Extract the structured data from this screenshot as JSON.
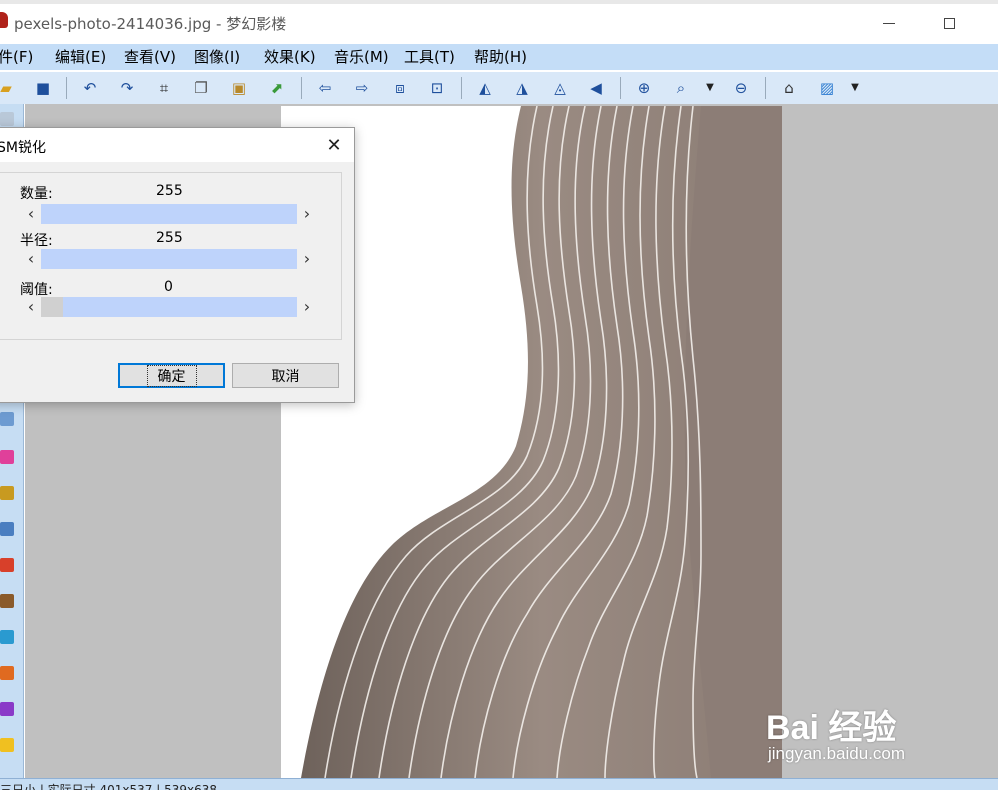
{
  "window": {
    "title": "pexels-photo-2414036.jpg - 梦幻影楼"
  },
  "menu": [
    {
      "label": "件(F)"
    },
    {
      "label": "编辑(E)"
    },
    {
      "label": "查看(V)"
    },
    {
      "label": "图像(I)"
    },
    {
      "label": "效果(K)"
    },
    {
      "label": "音乐(M)"
    },
    {
      "label": "工具(T)"
    },
    {
      "label": "帮助(H)"
    }
  ],
  "toolbar": {
    "icons": [
      "open-folder-icon",
      "save-icon",
      "undo-icon",
      "redo-icon",
      "crop-icon",
      "copy-icon",
      "paste-icon",
      "export-icon",
      "arrow-left-icon",
      "arrow-right-icon",
      "fit-window-icon",
      "actual-size-icon",
      "flip-icon",
      "mirror-icon",
      "rotate-icon",
      "triangle-icon",
      "zoom-in-icon",
      "zoom-icon",
      "zoom-out-icon",
      "home-icon",
      "wallpaper-icon"
    ]
  },
  "dialog": {
    "title": "SM锐化",
    "close_symbol": "✕",
    "fields": [
      {
        "label": "数量:",
        "value": "255",
        "level": 1.0
      },
      {
        "label": "半径:",
        "value": "255",
        "level": 1.0
      },
      {
        "label": "阈值:",
        "value": "0",
        "level": 0.0
      }
    ],
    "ok_label": "确定",
    "cancel_label": "取消"
  },
  "status": {
    "text": "三日小 | 实际日寸    401x537 | 539x638"
  },
  "watermark": {
    "logo": "Bai 经验",
    "url": "jingyan.baidu.com"
  },
  "colors": {
    "menubar": "#c4ddf7",
    "toolbar": "#d9e8f8",
    "slider_fill": "#bed3fb",
    "workspace": "#c0c0c0",
    "primary_border": "#0078d7"
  }
}
